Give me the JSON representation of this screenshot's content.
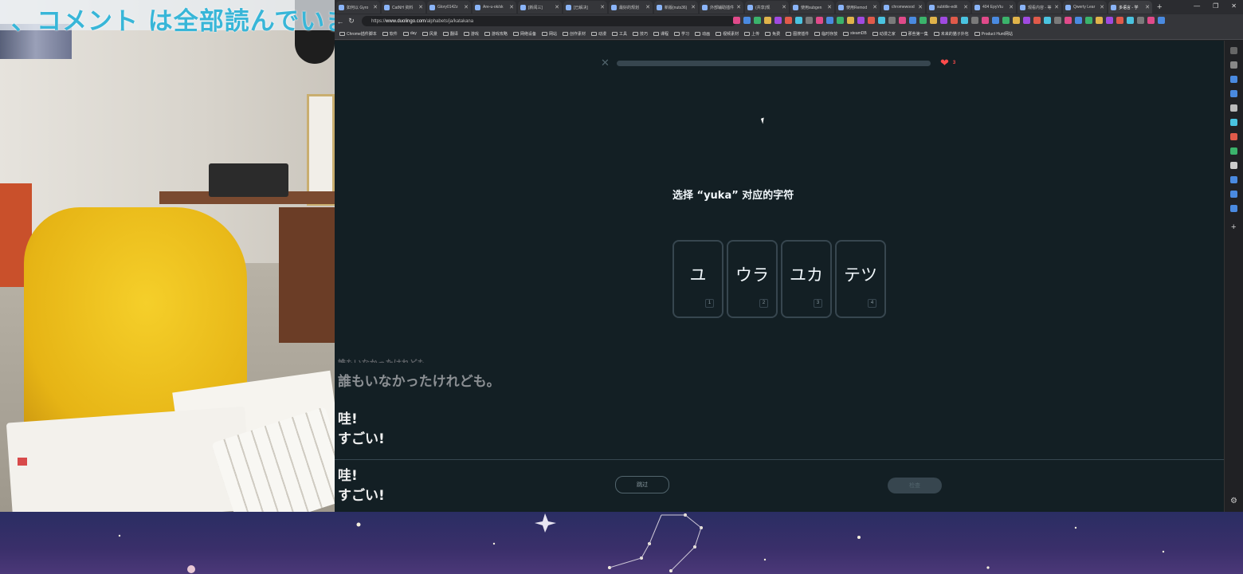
{
  "webcam": {
    "banner_text": "、コメント は全部読んでいま"
  },
  "browser": {
    "tabs": [
      {
        "title": "如何以 Gyro"
      },
      {
        "title": "CatNH 资料"
      },
      {
        "title": "Glory0142z"
      },
      {
        "title": "Are-u-ok/sk"
      },
      {
        "title": "[新闻三]"
      },
      {
        "title": "[已解决]"
      },
      {
        "title": "最好的规划"
      },
      {
        "title": "新版(nuts36)"
      },
      {
        "title": "外部辅助插件"
      },
      {
        "title": "(共享)规"
      },
      {
        "title": "使用subgen"
      },
      {
        "title": "使用Remod"
      },
      {
        "title": "chromewood"
      },
      {
        "title": "subtitle-edit"
      },
      {
        "title": "404 EpyVtu"
      },
      {
        "title": "观看内容 - 等"
      },
      {
        "title": "Qwerty Lear"
      },
      {
        "title": "多语言 - 学"
      }
    ],
    "active_tab_index": 17,
    "url_prefix": "https://",
    "url_host": "www.duolingo.com",
    "url_path": "/alphabets/ja/katakana",
    "bookmarks": [
      "Chrome插件脚本",
      "软件",
      "day",
      "风景",
      "翻译",
      "游戏",
      "游戏攻略",
      "网络设备",
      "网站",
      "创作素材",
      "动漫",
      "工具",
      "技巧",
      "课程",
      "学习",
      "动画",
      "视频素材",
      "上传",
      "免费",
      "图搜插件",
      "临时存放",
      "steamDB",
      "动漫之家",
      "那些第一集",
      "未来的猫子外包",
      "Product Hunt网站"
    ]
  },
  "lesson": {
    "close_icon": "close-icon",
    "progress_fraction": 0.0,
    "hearts": "3",
    "prompt": "选择 “yuka” 对应的字符",
    "choices": [
      {
        "char": "ユ",
        "key": "1"
      },
      {
        "char": "ウラ",
        "key": "2"
      },
      {
        "char": "ユカ",
        "key": "3"
      },
      {
        "char": "テツ",
        "key": "4"
      }
    ],
    "skip_label": "跳过",
    "check_label": "检查"
  },
  "subtitles": {
    "faded_top": "誰もいなかったけれども。",
    "faded_line": "誰もいなかったけれども。",
    "block_a": [
      "哇!",
      "すごい!"
    ],
    "block_b": [
      "哇!",
      "すごい!"
    ]
  },
  "colors": {
    "page_bg": "#131f24",
    "border": "#37464f",
    "heart": "#ff4b4b",
    "banner_text": "#38b6d8"
  }
}
